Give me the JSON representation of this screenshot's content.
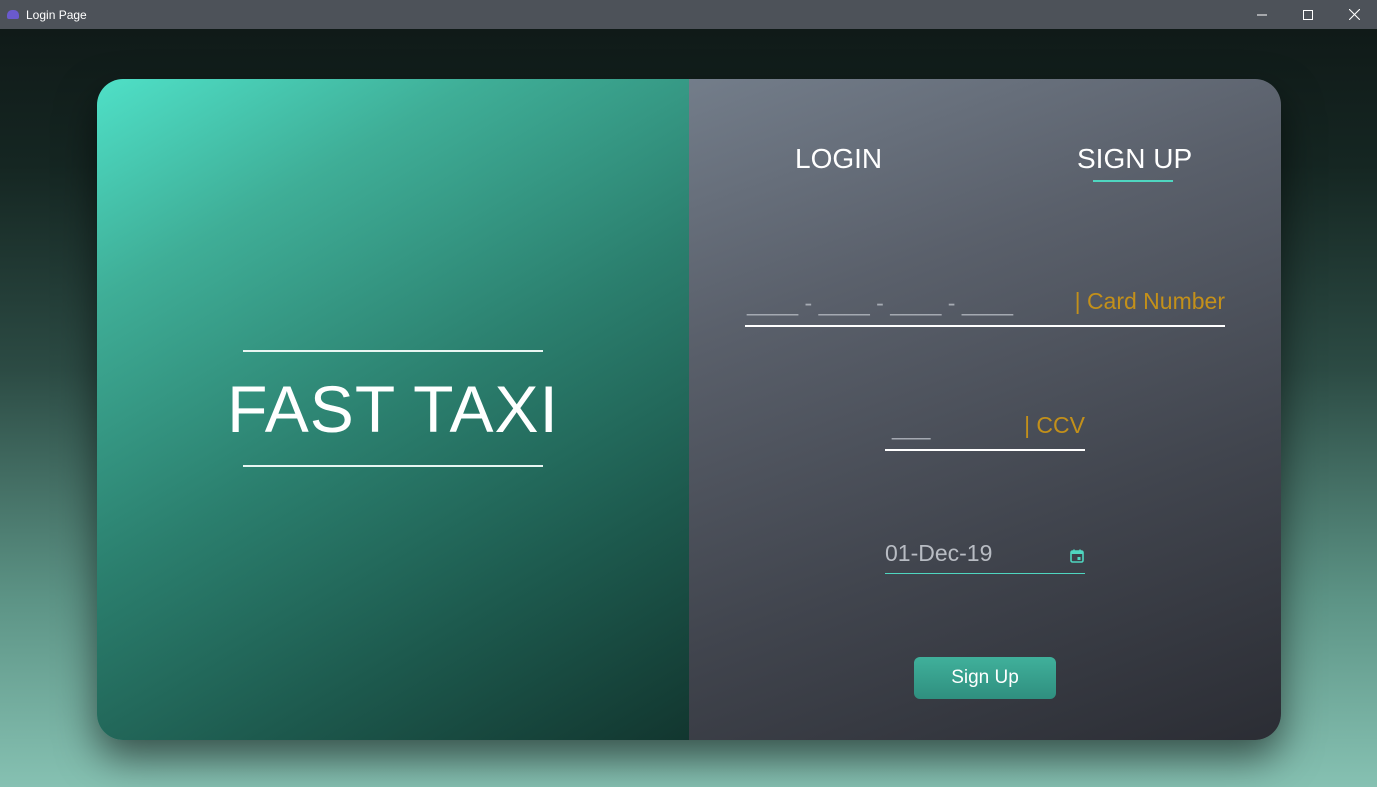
{
  "window": {
    "title": "Login Page"
  },
  "brand": {
    "title": "FAST TAXI"
  },
  "tabs": {
    "login": "LOGIN",
    "signup": "SIGN UP",
    "active": "signup"
  },
  "form": {
    "card_number": {
      "mask": "____ - ____ - ____ - ____",
      "hint": "| Card Number"
    },
    "ccv": {
      "mask": "___",
      "hint": "| CCV"
    },
    "date": {
      "value": "01-Dec-19"
    },
    "submit_label": "Sign Up"
  },
  "colors": {
    "accent": "#4fd6c0",
    "hint": "#c3901a",
    "button": "#3aa290"
  },
  "icons": {
    "calendar": "calendar-icon",
    "minimize": "minimize-icon",
    "maximize": "maximize-icon",
    "close": "close-icon"
  }
}
